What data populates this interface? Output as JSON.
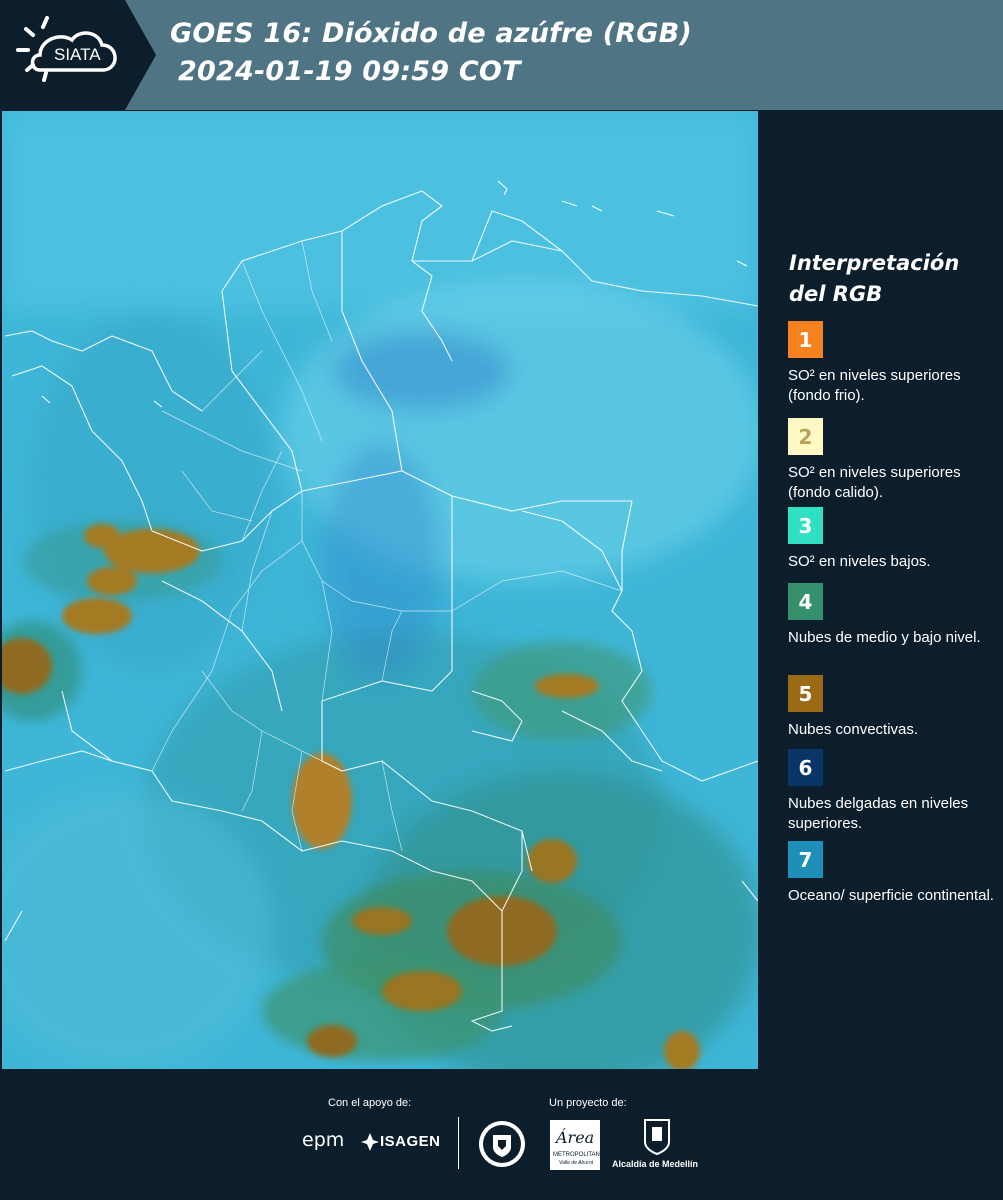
{
  "header": {
    "logo_text": "SIATA",
    "title_line1": "GOES 16: Dióxido de azúfre (RGB)",
    "title_line2": "2024-01-19 09:59 COT"
  },
  "legend": {
    "title": "Interpretación del RGB",
    "items": [
      {
        "number": "1",
        "color": "#f5821f",
        "text_color": "#ffffff",
        "label": "SO² en niveles superiores (fondo frio)."
      },
      {
        "number": "2",
        "color": "#fff8c5",
        "text_color": "#b7a25a",
        "label": "SO² en niveles superiores (fondo calido)."
      },
      {
        "number": "3",
        "color": "#2fe0c2",
        "text_color": "#ffffff",
        "label": "SO² en niveles bajos."
      },
      {
        "number": "4",
        "color": "#35916d",
        "text_color": "#ffffff",
        "label": "Nubes de medio y bajo nivel."
      },
      {
        "number": "5",
        "color": "#9a6a14",
        "text_color": "#ffffff",
        "label": "Nubes convectivas."
      },
      {
        "number": "6",
        "color": "#0a3567",
        "text_color": "#ffffff",
        "label": "Nubes delgadas en niveles superiores."
      },
      {
        "number": "7",
        "color": "#1e8fb8",
        "text_color": "#ffffff",
        "label": "Oceano/ superficie continental."
      }
    ]
  },
  "footer": {
    "support_label": "Con el apoyo de:",
    "project_label": "Un proyecto de:",
    "epm_text": "epm",
    "isagen_text": "ISAGEN",
    "area_text": "Área",
    "metropolitana_text": "METROPOLITANA",
    "valle_text": "Valle de Aburrá",
    "alcaldia_text": "Alcaldía de Medellín"
  },
  "colors": {
    "header_bg": "#4f7584",
    "panel_bg": "#0c1e2b",
    "map_ocean": "#3fb6d8",
    "map_land": "#3b9bb0",
    "convective": "#a47a22",
    "boundary": "#ffffff"
  }
}
